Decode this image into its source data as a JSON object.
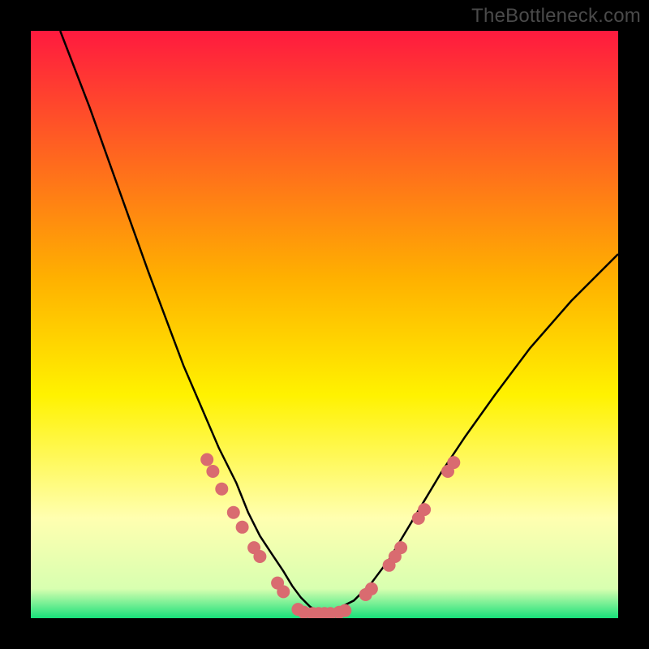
{
  "watermark": "TheBottleneck.com",
  "colors": {
    "frame": "#000000",
    "gradient_top": "#ff1a3f",
    "gradient_mid1": "#ffb000",
    "gradient_mid2": "#fff200",
    "gradient_pale": "#ffffb0",
    "gradient_green": "#18e07a",
    "curve": "#000000",
    "marker_fill": "#d96b70",
    "marker_stroke": "#c94f55"
  },
  "chart_data": {
    "type": "line",
    "title": "",
    "xlabel": "",
    "ylabel": "",
    "xlim": [
      0,
      100
    ],
    "ylim": [
      0,
      100
    ],
    "grid": false,
    "legend": false,
    "series": [
      {
        "name": "bottleneck-curve",
        "x": [
          5,
          10,
          15,
          20,
          23,
          26,
          29,
          32,
          35,
          37,
          39,
          41,
          43,
          44.5,
          46,
          47.5,
          49,
          50.5,
          52,
          55,
          58,
          61,
          64,
          67,
          70,
          74,
          79,
          85,
          92,
          100
        ],
        "y": [
          100,
          87,
          73,
          59,
          51,
          43,
          36,
          29,
          23,
          18,
          14,
          11,
          8,
          5.5,
          3.5,
          2,
          1,
          1,
          1.5,
          3,
          6,
          10,
          15,
          20,
          25,
          31,
          38,
          46,
          54,
          62
        ]
      }
    ],
    "markers": [
      {
        "x": 30.0,
        "y": 27.0
      },
      {
        "x": 31.0,
        "y": 25.0
      },
      {
        "x": 32.5,
        "y": 22.0
      },
      {
        "x": 34.5,
        "y": 18.0
      },
      {
        "x": 36.0,
        "y": 15.5
      },
      {
        "x": 38.0,
        "y": 12.0
      },
      {
        "x": 39.0,
        "y": 10.5
      },
      {
        "x": 42.0,
        "y": 6.0
      },
      {
        "x": 43.0,
        "y": 4.5
      },
      {
        "x": 45.5,
        "y": 1.5
      },
      {
        "x": 46.5,
        "y": 1.0
      },
      {
        "x": 48.0,
        "y": 0.8
      },
      {
        "x": 49.0,
        "y": 0.8
      },
      {
        "x": 50.0,
        "y": 0.8
      },
      {
        "x": 51.0,
        "y": 0.8
      },
      {
        "x": 52.5,
        "y": 1.0
      },
      {
        "x": 53.5,
        "y": 1.3
      },
      {
        "x": 57.0,
        "y": 4.0
      },
      {
        "x": 58.0,
        "y": 5.0
      },
      {
        "x": 61.0,
        "y": 9.0
      },
      {
        "x": 62.0,
        "y": 10.5
      },
      {
        "x": 63.0,
        "y": 12.0
      },
      {
        "x": 66.0,
        "y": 17.0
      },
      {
        "x": 67.0,
        "y": 18.5
      },
      {
        "x": 71.0,
        "y": 25.0
      },
      {
        "x": 72.0,
        "y": 26.5
      }
    ]
  }
}
